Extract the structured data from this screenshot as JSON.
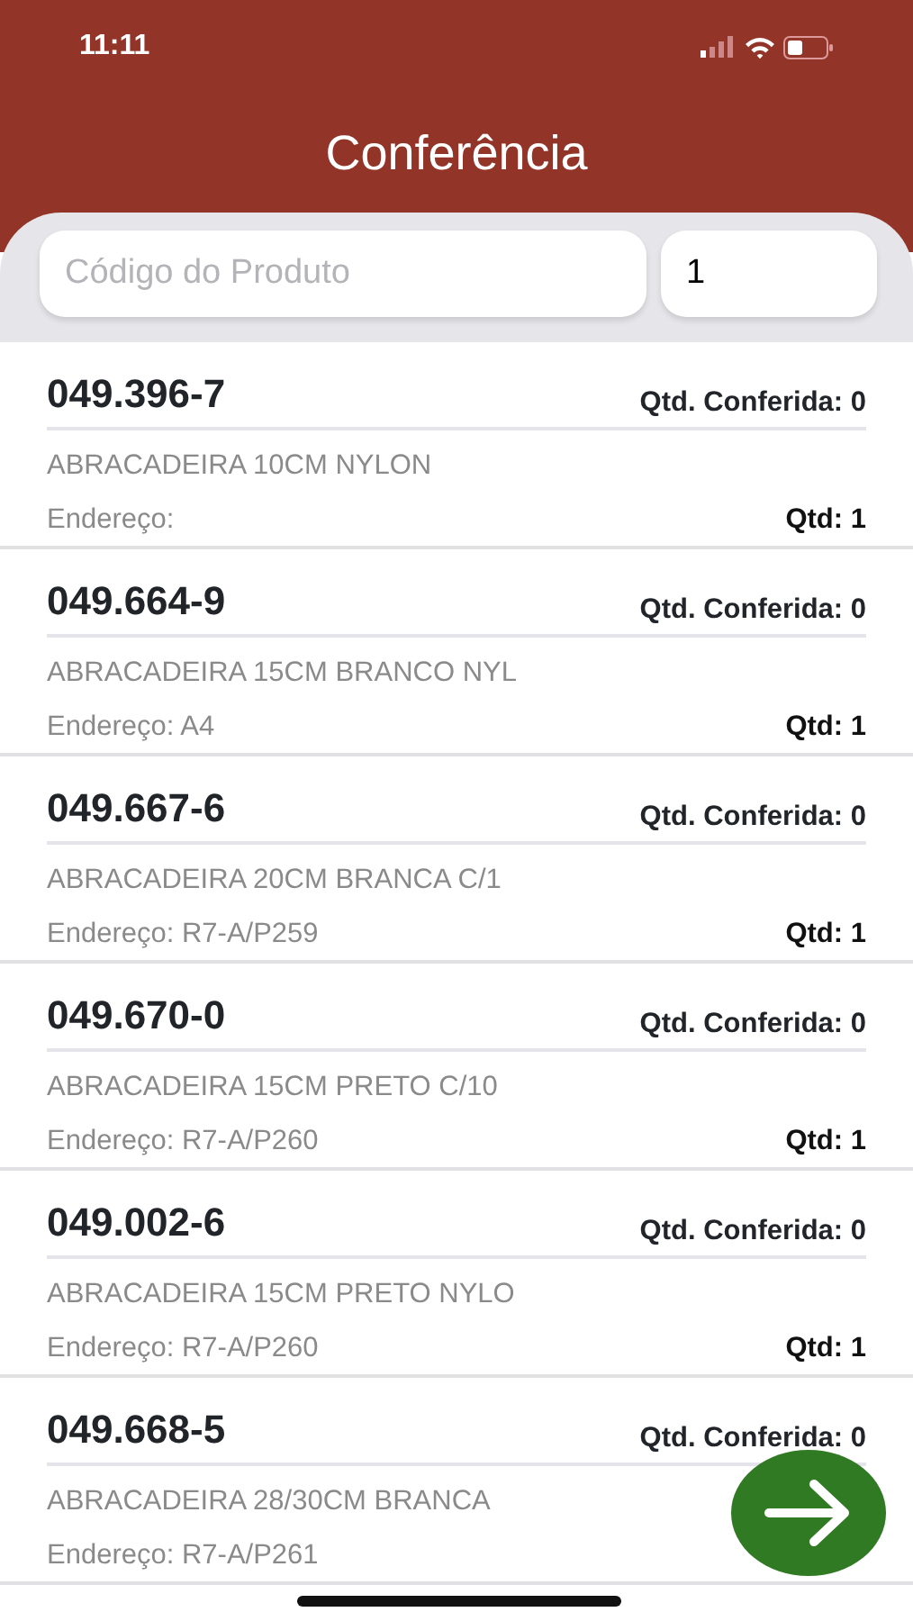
{
  "status_bar": {
    "time": "11:11"
  },
  "title": "Conferência",
  "search": {
    "placeholder": "Código do Produto",
    "quantity": "1"
  },
  "items": [
    {
      "code": "049.396-7",
      "checked_label": "Qtd. Conferida: 0",
      "description": "ABRACADEIRA 10CM NYLON",
      "address": "Endereço:",
      "qty": "Qtd: 1"
    },
    {
      "code": "049.664-9",
      "checked_label": "Qtd. Conferida: 0",
      "description": "ABRACADEIRA 15CM BRANCO NYL",
      "address": "Endereço: A4",
      "qty": "Qtd: 1"
    },
    {
      "code": "049.667-6",
      "checked_label": "Qtd. Conferida: 0",
      "description": "ABRACADEIRA 20CM BRANCA C/1",
      "address": "Endereço: R7-A/P259",
      "qty": "Qtd: 1"
    },
    {
      "code": "049.670-0",
      "checked_label": "Qtd. Conferida: 0",
      "description": "ABRACADEIRA 15CM PRETO C/10",
      "address": "Endereço: R7-A/P260",
      "qty": "Qtd: 1"
    },
    {
      "code": "049.002-6",
      "checked_label": "Qtd. Conferida: 0",
      "description": "ABRACADEIRA 15CM PRETO NYLO",
      "address": "Endereço: R7-A/P260",
      "qty": "Qtd: 1"
    },
    {
      "code": "049.668-5",
      "checked_label": "Qtd. Conferida: 0",
      "description": "ABRACADEIRA 28/30CM BRANCA",
      "address": "Endereço: R7-A/P261"
    }
  ]
}
